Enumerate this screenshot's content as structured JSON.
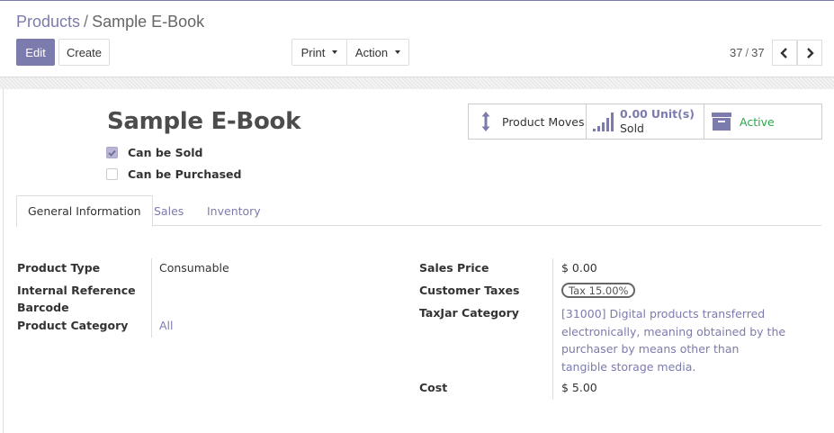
{
  "breadcrumb": {
    "parent": "Products",
    "separator": "/",
    "current": "Sample E-Book"
  },
  "toolbar": {
    "edit_label": "Edit",
    "create_label": "Create",
    "print_label": "Print",
    "action_label": "Action"
  },
  "pager": {
    "current": "37",
    "separator": "/",
    "total": "37"
  },
  "record": {
    "title": "Sample E-Book"
  },
  "options": {
    "can_be_sold": {
      "label": "Can be Sold",
      "checked": true
    },
    "can_be_purchased": {
      "label": "Can be Purchased",
      "checked": false
    }
  },
  "smart_buttons": {
    "product_moves": {
      "label": "Product Moves",
      "icon": "up-down-arrows-icon"
    },
    "sold": {
      "value": "0.00",
      "unit": "Unit(s)",
      "label": "Sold",
      "icon": "bar-chart-icon"
    },
    "active": {
      "label": "Active",
      "icon": "archive-icon",
      "color": "#28a745"
    }
  },
  "tabs": [
    {
      "label": "General Information",
      "active": true
    },
    {
      "label": "Sales",
      "active": false
    },
    {
      "label": "Inventory",
      "active": false
    }
  ],
  "general": {
    "product_type": {
      "label": "Product Type",
      "value": "Consumable"
    },
    "internal_reference": {
      "label": "Internal Reference",
      "value": ""
    },
    "barcode": {
      "label": "Barcode",
      "value": ""
    },
    "product_category": {
      "label": "Product Category",
      "value": "All"
    },
    "sales_price": {
      "label": "Sales Price",
      "value": "$ 0.00"
    },
    "customer_taxes": {
      "label": "Customer Taxes",
      "value": "Tax 15.00%"
    },
    "taxjar_category": {
      "label": "TaxJar Category",
      "value": "[31000] Digital products transferred electronically, meaning obtained by the purchaser by means other than tangible storage media."
    },
    "cost": {
      "label": "Cost",
      "value": "$ 5.00"
    }
  },
  "colors": {
    "brand": "#7c7bad",
    "active": "#28a745",
    "text": "#4c4c4c"
  }
}
